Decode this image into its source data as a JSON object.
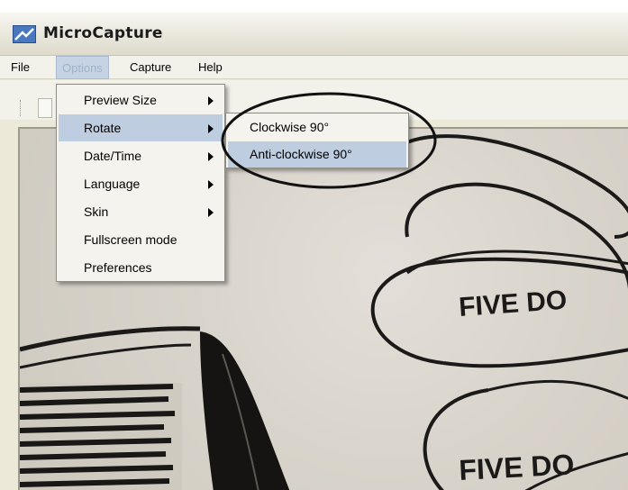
{
  "window": {
    "title": "MicroCapture"
  },
  "menubar": {
    "items": [
      {
        "label": "File"
      },
      {
        "label": "Options"
      },
      {
        "label": "Capture"
      },
      {
        "label": "Help"
      }
    ]
  },
  "options_menu": {
    "items": [
      {
        "label": "Preview Size",
        "submenu": true
      },
      {
        "label": "Rotate",
        "submenu": true
      },
      {
        "label": "Date/Time",
        "submenu": true
      },
      {
        "label": "Language",
        "submenu": true
      },
      {
        "label": "Skin",
        "submenu": true
      },
      {
        "label": "Fullscreen mode",
        "submenu": false
      },
      {
        "label": "Preferences",
        "submenu": false
      }
    ]
  },
  "rotate_submenu": {
    "items": [
      {
        "label": "Clockwise 90°"
      },
      {
        "label": "Anti-clockwise 90°"
      }
    ]
  },
  "preview": {
    "text_top": "FIVE DO",
    "text_bottom": "FIVE DO"
  },
  "colors": {
    "highlight": "#bfcde0",
    "menu_bg": "#f4f3ee",
    "title_bg": "#e5e3d6"
  },
  "icons": [
    "app-icon",
    "toolbar-grip-icon",
    "submenu-arrow-icon"
  ]
}
